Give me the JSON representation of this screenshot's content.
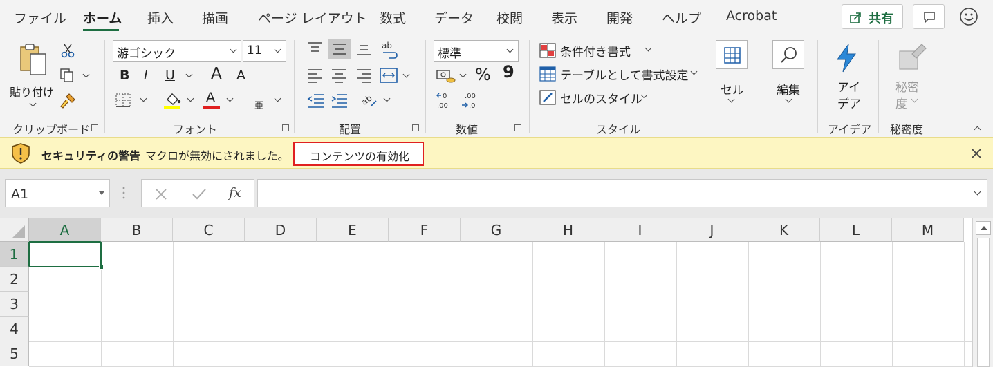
{
  "menu": {
    "tabs": [
      "ファイル",
      "ホーム",
      "挿入",
      "描画",
      "ページ レイアウト",
      "数式",
      "データ",
      "校閲",
      "表示",
      "開発",
      "ヘルプ",
      "Acrobat"
    ],
    "share_label": "共有"
  },
  "ribbon": {
    "clipboard": {
      "paste_line1": "貼り付け",
      "label": "クリップボード"
    },
    "font": {
      "name": "游ゴシック",
      "size": "11",
      "bold": "B",
      "italic": "I",
      "underline": "U",
      "grow": "A",
      "shrink": "A",
      "font_color": "A",
      "phonetic": "亜",
      "label": "フォント"
    },
    "alignment": {
      "wrap": "ab",
      "label": "配置"
    },
    "number": {
      "format": "標準",
      "percent": "%",
      "comma": "9",
      "label": "数値"
    },
    "styles": {
      "conditional": "条件付き書式",
      "table": "テーブルとして書式設定",
      "cell_style": "セルのスタイル",
      "label": "スタイル"
    },
    "cells": {
      "label": "セル"
    },
    "editing": {
      "label": "編集"
    },
    "ideas": {
      "line1": "アイ",
      "line2": "デア",
      "label": "アイデア"
    },
    "sensitivity": {
      "line1": "秘密",
      "line2": "度",
      "label": "秘密度"
    }
  },
  "security_bar": {
    "title": "セキュリティの警告",
    "message": "マクロが無効にされました。",
    "enable_button": "コンテンツの有効化"
  },
  "formula_bar": {
    "name_box": "A1",
    "fx": "fx"
  },
  "sheet": {
    "columns": [
      "A",
      "B",
      "C",
      "D",
      "E",
      "F",
      "G",
      "H",
      "I",
      "J",
      "K",
      "L",
      "M"
    ],
    "rows": [
      "1",
      "2",
      "3",
      "4",
      "5"
    ],
    "active_cell": "A1"
  },
  "colors": {
    "accent": "#1e6e42",
    "security_bg": "#fdf6c2",
    "highlight_border": "#e02020"
  }
}
